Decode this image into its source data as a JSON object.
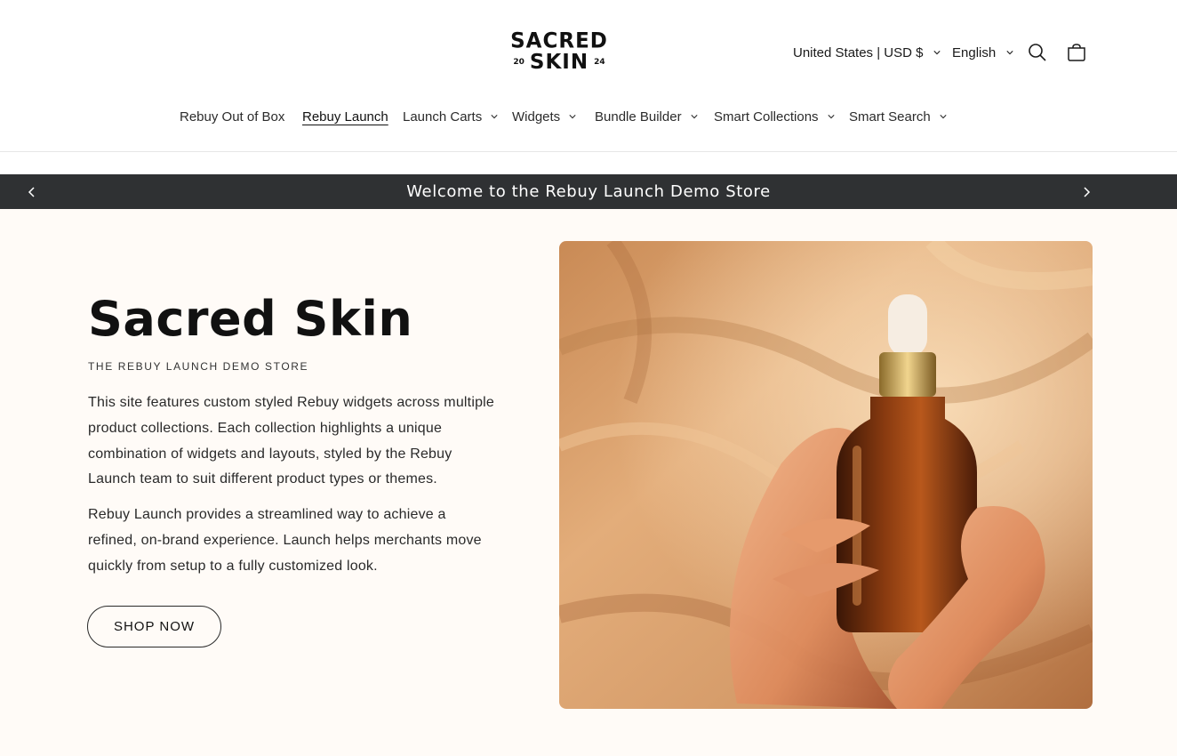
{
  "brand": {
    "logo_line1": "SACRED",
    "logo_year_left": "20",
    "logo_line2": "SKIN",
    "logo_year_right": "24"
  },
  "header": {
    "country_selector": "United States | USD $",
    "language_selector": "English",
    "icons": [
      "search-icon",
      "cart-icon"
    ]
  },
  "nav": {
    "items": [
      {
        "label": "Rebuy Out of Box",
        "has_dropdown": false,
        "active": false
      },
      {
        "label": "Rebuy Launch",
        "has_dropdown": false,
        "active": true
      },
      {
        "label": "Launch Carts",
        "has_dropdown": true,
        "active": false
      },
      {
        "label": "Widgets",
        "has_dropdown": true,
        "active": false
      },
      {
        "label": "Bundle Builder",
        "has_dropdown": true,
        "active": false
      },
      {
        "label": "Smart Collections",
        "has_dropdown": true,
        "active": false
      },
      {
        "label": "Smart Search",
        "has_dropdown": true,
        "active": false
      }
    ]
  },
  "announcement": {
    "text": "Welcome to the Rebuy Launch Demo Store",
    "icons": [
      "chevron-left-icon",
      "chevron-right-icon"
    ]
  },
  "hero": {
    "title": "Sacred Skin",
    "subtitle": "THE REBUY LAUNCH DEMO STORE",
    "paragraph1": "This site features custom styled Rebuy widgets across multiple product collections. Each collection highlights a unique combination of widgets and layouts, styled by the Rebuy Launch team to suit different product types or themes.",
    "paragraph2": "Rebuy Launch provides a streamlined way to achieve a refined, on-brand experience. Launch helps merchants move quickly from setup to a fully customized look.",
    "button_label": "SHOP NOW"
  },
  "colors": {
    "announcement_bg": "#2f3133",
    "hero_bg": "#fffbf7",
    "text": "#1a1a1a"
  }
}
